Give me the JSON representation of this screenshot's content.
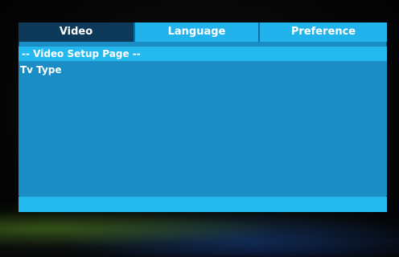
{
  "tabs": [
    {
      "label": "Video",
      "active": true
    },
    {
      "label": "Language",
      "active": false
    },
    {
      "label": "Preference",
      "active": false
    }
  ],
  "page": {
    "header": "-- Video Setup Page --"
  },
  "menu": {
    "items": [
      {
        "label": "Tv Type"
      }
    ]
  },
  "status": {
    "text": ""
  },
  "colors": {
    "panel": "#1a8ec4",
    "tab_active": "#0e3a5a",
    "tab_inactive": "#21b4ec",
    "header_bar": "#23b8ee",
    "text": "#ffffff"
  }
}
